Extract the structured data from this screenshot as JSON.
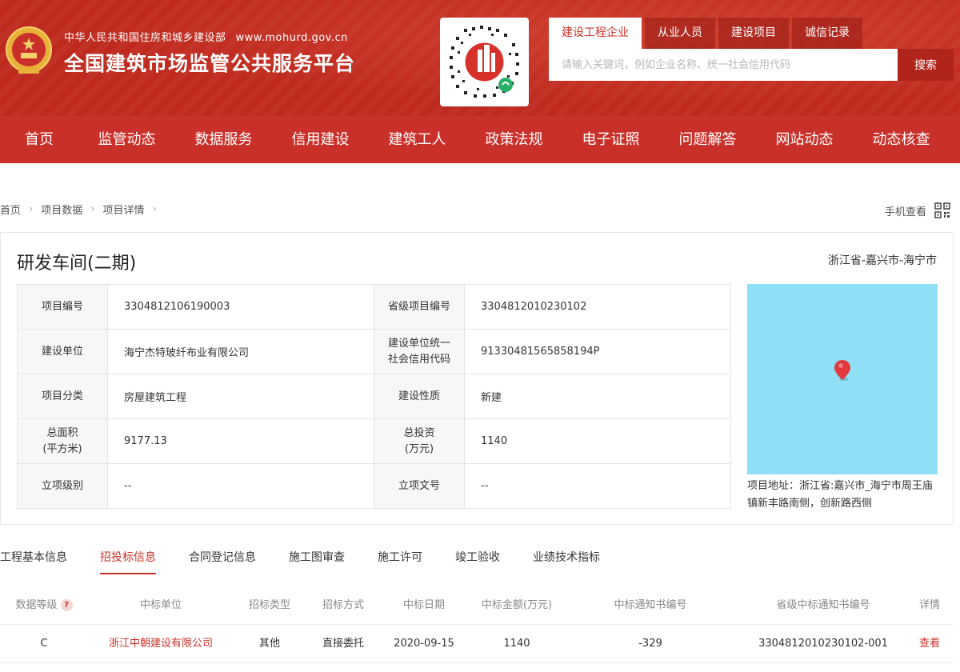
{
  "header": {
    "ministry": "中华人民共和国住房和城乡建设部",
    "url": "www.mohurd.gov.cn",
    "site_title": "全国建筑市场监管公共服务平台"
  },
  "search": {
    "tabs": [
      "建设工程企业",
      "从业人员",
      "建设项目",
      "诚信记录"
    ],
    "active_tab": "建设工程企业",
    "placeholder": "请输入关键词，例如企业名称、统一社会信用代码",
    "button": "搜索"
  },
  "nav": [
    "首页",
    "监管动态",
    "数据服务",
    "信用建设",
    "建筑工人",
    "政策法规",
    "电子证照",
    "问题解答",
    "网站动态",
    "动态核查"
  ],
  "breadcrumb": [
    "首页",
    "项目数据",
    "项目详情"
  ],
  "mobile_view": "手机查看",
  "project": {
    "title": "研发车间(二期)",
    "region": "浙江省-嘉兴市-海宁市",
    "rows": [
      {
        "l1": "项目编号",
        "v1": "3304812106190003",
        "l2": "省级项目编号",
        "v2": "3304812010230102"
      },
      {
        "l1": "建设单位",
        "v1": "海宁杰特玻纤布业有限公司",
        "l2": "建设单位统一\n社会信用代码",
        "v2": "91330481565858194P"
      },
      {
        "l1": "项目分类",
        "v1": "房屋建筑工程",
        "l2": "建设性质",
        "v2": "新建"
      },
      {
        "l1": "总面积\n(平方米)",
        "v1": "9177.13",
        "l2": "总投资\n(万元)",
        "v2": "1140"
      },
      {
        "l1": "立项级别",
        "v1": "--",
        "l2": "立项文号",
        "v2": "--"
      }
    ],
    "address_label": "项目地址：",
    "address": "浙江省:嘉兴市_海宁市周王庙镇新丰路南侧，创新路西侧"
  },
  "tabs": [
    "工程基本信息",
    "招投标信息",
    "合同登记信息",
    "施工图审查",
    "施工许可",
    "竣工验收",
    "业绩技术指标"
  ],
  "active_tab": "招投标信息",
  "bids": {
    "headers": [
      "数据等级",
      "中标单位",
      "招标类型",
      "招标方式",
      "中标日期",
      "中标金额(万元)",
      "中标通知书编号",
      "省级中标通知书编号",
      "详情"
    ],
    "help_mark": "?",
    "rows": [
      {
        "level": "C",
        "winner": "浙江中朝建设有限公司",
        "type": "其他",
        "method": "直接委托",
        "date": "2020-09-15",
        "amount": "1140",
        "notice_no": "-329",
        "prov_notice_no": "3304812010230102-001",
        "detail": "查看"
      }
    ]
  },
  "colors": {
    "brand_red": "#c9302a",
    "map_water": "#8fdff7",
    "link_red": "#c8322a"
  }
}
